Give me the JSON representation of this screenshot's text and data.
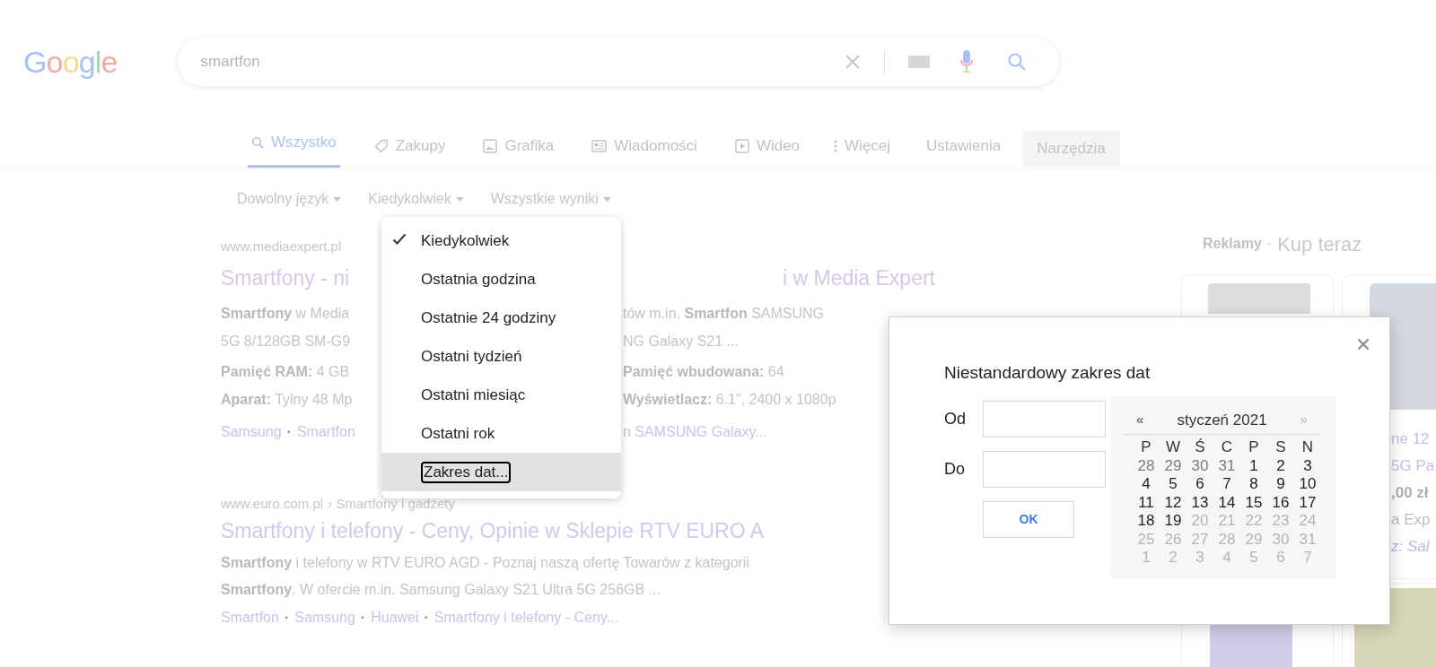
{
  "logo": {
    "text": "Google"
  },
  "search": {
    "value": "smartfon"
  },
  "tabs": [
    {
      "label": "Wszystko",
      "selected": true,
      "pressed": false
    },
    {
      "label": "Zakupy",
      "selected": false,
      "pressed": false
    },
    {
      "label": "Grafika",
      "selected": false,
      "pressed": false
    },
    {
      "label": "Wiadomości",
      "selected": false,
      "pressed": false
    },
    {
      "label": "Wideo",
      "selected": false,
      "pressed": false
    },
    {
      "label": "Więcej",
      "selected": false,
      "pressed": false
    },
    {
      "label": "Ustawienia",
      "selected": false,
      "pressed": false
    },
    {
      "label": "Narzędzia",
      "selected": false,
      "pressed": true
    }
  ],
  "tools": [
    {
      "label": "Dowolny język"
    },
    {
      "label": "Kiedykolwiek"
    },
    {
      "label": "Wszystkie wyniki"
    }
  ],
  "time_menu": {
    "items": [
      {
        "label": "Kiedykolwiek",
        "selected": true,
        "focused": false
      },
      {
        "label": "Ostatnia godzina",
        "selected": false,
        "focused": false
      },
      {
        "label": "Ostatnie 24 godziny",
        "selected": false,
        "focused": false
      },
      {
        "label": "Ostatni tydzień",
        "selected": false,
        "focused": false
      },
      {
        "label": "Ostatni miesiąc",
        "selected": false,
        "focused": false
      },
      {
        "label": "Ostatni rok",
        "selected": false,
        "focused": false
      },
      {
        "label": "Zakres dat...",
        "selected": false,
        "focused": true
      }
    ]
  },
  "result_1": {
    "url": "www.mediaexpert.pl",
    "title_left": "Smartfony - ni",
    "title_right": "i w Media Expert",
    "lines": [
      {
        "left": "**Smartfony** w Media",
        "right": "tów m.in. **Smartfon** SAMSUNG"
      },
      {
        "left": "5G 8/128GB SM-G9",
        "right": "NG Galaxy S21 ..."
      },
      {
        "left": "**Pamięć RAM:** 4 GB",
        "right": "**Pamięć wbudowana:** 64"
      },
      {
        "left": "**Aparat:** Tylny 48 Mp",
        "right": "**Wyświetlacz:** 6.1\", 2400 x 1080p"
      }
    ],
    "links_left": [
      "Samsung",
      "Smartfon"
    ],
    "links_right": "n SAMSUNG Galaxy...",
    "separator": "·"
  },
  "result_2": {
    "url": "www.euro.com.pl",
    "breadcrumb": "› Smartfony i gadżety",
    "title": "Smartfony i telefony - Ceny, Opinie w Sklepie RTV EURO A",
    "lines": [
      "**Smartfony** i telefony w RTV EURO AGD - Poznaj naszą ofertę Towarów z kategorii",
      "**Smartfony**. W ofercie m.in. Samsung Galaxy S21 Ultra 5G 256GB ..."
    ],
    "links": [
      "Smartfon",
      "Samsung",
      "Huawei",
      "Smartfony i telefony - Ceny..."
    ],
    "separator": "·"
  },
  "ads": {
    "label": "Reklamy",
    "separator": "·",
    "title": "Kup teraz",
    "card_text": [
      {
        "text": "ne 12",
        "kind": "title"
      },
      {
        "text": "5G Pa",
        "kind": "title"
      },
      {
        "text": ",00 zł",
        "kind": "price"
      },
      {
        "text": "a Exp",
        "kind": "seller"
      },
      {
        "text": "z: Sal",
        "kind": "note"
      }
    ]
  },
  "dialog": {
    "title": "Niestandardowy zakres dat",
    "from_label": "Od",
    "to_label": "Do",
    "ok": "OK",
    "calendar": {
      "prev": "«",
      "month": "styczeń 2021",
      "next": "»",
      "next_disabled": true,
      "weekdays": [
        "P",
        "W",
        "Ś",
        "C",
        "P",
        "S",
        "N"
      ],
      "weeks": [
        [
          {
            "day": "28",
            "kind": "other"
          },
          {
            "day": "29",
            "kind": "other"
          },
          {
            "day": "30",
            "kind": "other"
          },
          {
            "day": "31",
            "kind": "other"
          },
          {
            "day": "1",
            "kind": "current"
          },
          {
            "day": "2",
            "kind": "current"
          },
          {
            "day": "3",
            "kind": "current"
          }
        ],
        [
          {
            "day": "4",
            "kind": "current"
          },
          {
            "day": "5",
            "kind": "current"
          },
          {
            "day": "6",
            "kind": "current"
          },
          {
            "day": "7",
            "kind": "current"
          },
          {
            "day": "8",
            "kind": "current"
          },
          {
            "day": "9",
            "kind": "current"
          },
          {
            "day": "10",
            "kind": "current"
          }
        ],
        [
          {
            "day": "11",
            "kind": "current"
          },
          {
            "day": "12",
            "kind": "current"
          },
          {
            "day": "13",
            "kind": "current"
          },
          {
            "day": "14",
            "kind": "current"
          },
          {
            "day": "15",
            "kind": "current"
          },
          {
            "day": "16",
            "kind": "current"
          },
          {
            "day": "17",
            "kind": "current"
          }
        ],
        [
          {
            "day": "18",
            "kind": "current"
          },
          {
            "day": "19",
            "kind": "current"
          },
          {
            "day": "20",
            "kind": "disabled"
          },
          {
            "day": "21",
            "kind": "disabled"
          },
          {
            "day": "22",
            "kind": "disabled"
          },
          {
            "day": "23",
            "kind": "disabled"
          },
          {
            "day": "24",
            "kind": "disabled"
          }
        ],
        [
          {
            "day": "25",
            "kind": "disabled"
          },
          {
            "day": "26",
            "kind": "disabled"
          },
          {
            "day": "27",
            "kind": "disabled"
          },
          {
            "day": "28",
            "kind": "disabled"
          },
          {
            "day": "29",
            "kind": "disabled"
          },
          {
            "day": "30",
            "kind": "disabled"
          },
          {
            "day": "31",
            "kind": "disabled"
          }
        ],
        [
          {
            "day": "1",
            "kind": "disabled"
          },
          {
            "day": "2",
            "kind": "disabled"
          },
          {
            "day": "3",
            "kind": "disabled"
          },
          {
            "day": "4",
            "kind": "disabled"
          },
          {
            "day": "5",
            "kind": "disabled"
          },
          {
            "day": "6",
            "kind": "disabled"
          },
          {
            "day": "7",
            "kind": "disabled"
          }
        ]
      ]
    }
  }
}
